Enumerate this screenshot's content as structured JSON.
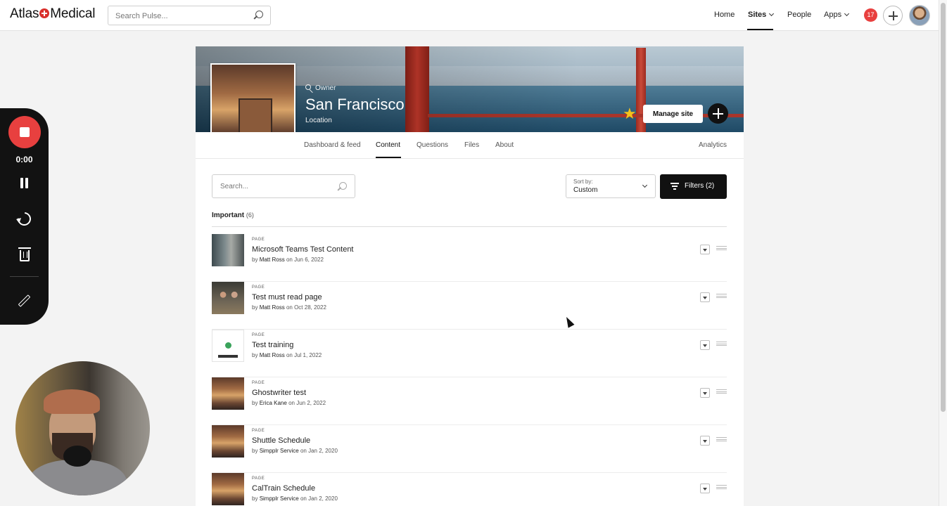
{
  "brand": {
    "part1": "Atlas",
    "part2": "Medical",
    "accent": "#d9302c"
  },
  "search": {
    "placeholder": "Search Pulse..."
  },
  "nav": {
    "home": "Home",
    "sites": "Sites",
    "people": "People",
    "apps": "Apps",
    "notification_count": "17"
  },
  "site": {
    "role": "Owner",
    "title": "San Francisco",
    "subtitle": "Location",
    "manage_label": "Manage site",
    "favorite_color": "#f4c21b"
  },
  "tabs": {
    "dashboard": "Dashboard & feed",
    "content": "Content",
    "questions": "Questions",
    "files": "Files",
    "about": "About",
    "analytics": "Analytics"
  },
  "content": {
    "search_placeholder": "Search...",
    "sort_label": "Sort by:",
    "sort_value": "Custom",
    "filters_label": "Filters (2)",
    "section_title": "Important",
    "section_count": "(6)",
    "items": [
      {
        "type": "PAGE",
        "title": "Microsoft Teams Test Content",
        "by": "by",
        "author": "Matt Ross",
        "on": "on",
        "date": "Jun 6, 2022"
      },
      {
        "type": "PAGE",
        "title": "Test must read page",
        "by": "by",
        "author": "Matt Ross",
        "on": "on",
        "date": "Oct 28, 2022"
      },
      {
        "type": "PAGE",
        "title": "Test training",
        "by": "by",
        "author": "Matt Ross",
        "on": "on",
        "date": "Jul 1, 2022"
      },
      {
        "type": "PAGE",
        "title": "Ghostwriter test",
        "by": "by",
        "author": "Erica Kane",
        "on": "on",
        "date": "Jun 2, 2022"
      },
      {
        "type": "PAGE",
        "title": "Shuttle Schedule",
        "by": "by",
        "author": "Simpplr Service",
        "on": "on",
        "date": "Jan 2, 2020"
      },
      {
        "type": "PAGE",
        "title": "CalTrain Schedule",
        "by": "by",
        "author": "Simpplr Service",
        "on": "on",
        "date": "Jan 2, 2020"
      }
    ]
  },
  "recorder": {
    "time": "0:00",
    "stop_color": "#e8403f"
  }
}
